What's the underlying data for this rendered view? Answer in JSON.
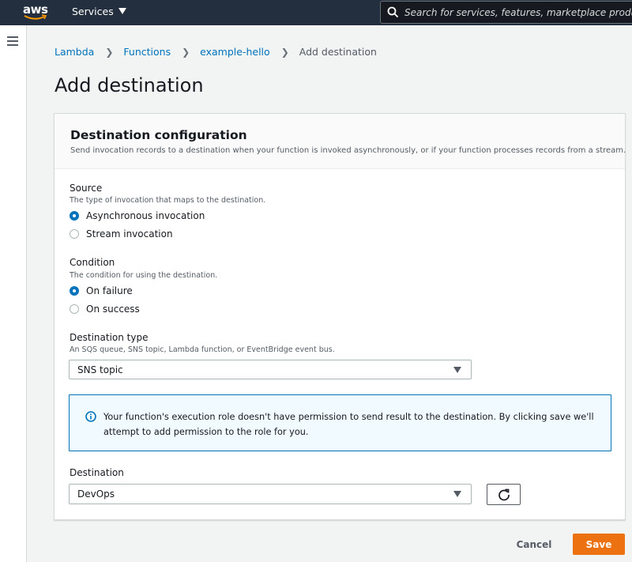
{
  "nav": {
    "logo_text": "aws",
    "services_label": "Services",
    "search_placeholder": "Search for services, features, marketplace products, and docs"
  },
  "breadcrumb": {
    "items": [
      "Lambda",
      "Functions",
      "example-hello"
    ],
    "current": "Add destination"
  },
  "page": {
    "title": "Add destination"
  },
  "panel": {
    "title": "Destination configuration",
    "description": "Send invocation records to a destination when your function is invoked asynchronously, or if your function processes records from a stream."
  },
  "source": {
    "label": "Source",
    "help": "The type of invocation that maps to the destination.",
    "options": [
      {
        "label": "Asynchronous invocation",
        "checked": true
      },
      {
        "label": "Stream invocation",
        "checked": false
      }
    ]
  },
  "condition": {
    "label": "Condition",
    "help": "The condition for using the destination.",
    "options": [
      {
        "label": "On failure",
        "checked": true
      },
      {
        "label": "On success",
        "checked": false
      }
    ]
  },
  "destination_type": {
    "label": "Destination type",
    "help": "An SQS queue, SNS topic, Lambda function, or EventBridge event bus.",
    "selected": "SNS topic"
  },
  "info": {
    "message": "Your function's execution role doesn't have permission to send result to the destination. By clicking save we'll attempt to add permission to the role for you."
  },
  "destination": {
    "label": "Destination",
    "selected": "DevOps"
  },
  "actions": {
    "cancel_label": "Cancel",
    "save_label": "Save"
  },
  "colors": {
    "nav_bg": "#232f3e",
    "link": "#0073bb",
    "primary_button": "#ec7211",
    "info_border": "#0073bb"
  }
}
